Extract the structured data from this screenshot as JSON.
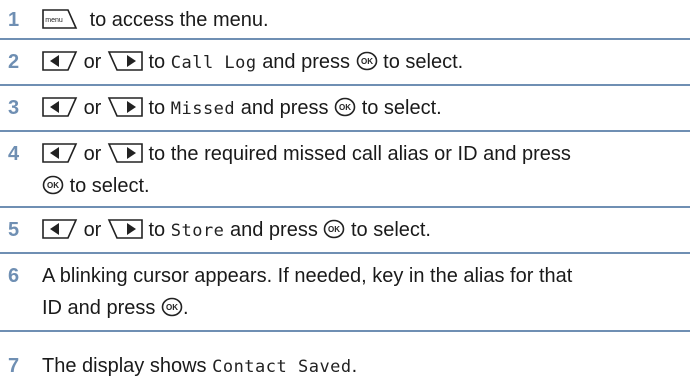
{
  "steps": [
    {
      "num": "1",
      "icons": {
        "menu": "menu"
      },
      "t1": "to access the menu."
    },
    {
      "num": "2",
      "or": "or",
      "t1": "to",
      "mono": "Call Log",
      "t2": "and press",
      "t3": "to select."
    },
    {
      "num": "3",
      "or": "or",
      "t1": "to",
      "mono": "Missed",
      "t2": "and press",
      "t3": "to select."
    },
    {
      "num": "4",
      "or": "or",
      "t1": "to the required missed call alias or ID and press",
      "t3": "to select."
    },
    {
      "num": "5",
      "or": "or",
      "t1": "to",
      "mono": "Store",
      "t2": "and press",
      "t3": "to select."
    },
    {
      "num": "6",
      "t1": "A blinking cursor appears. If needed, key in the alias for that",
      "t2": "ID and press",
      "t3": "."
    },
    {
      "num": "7",
      "t1": "The display shows",
      "mono": "Contact Saved",
      "t2": "."
    }
  ],
  "colors": {
    "accent": "#6f8fb3",
    "text": "#1a1a1a"
  }
}
